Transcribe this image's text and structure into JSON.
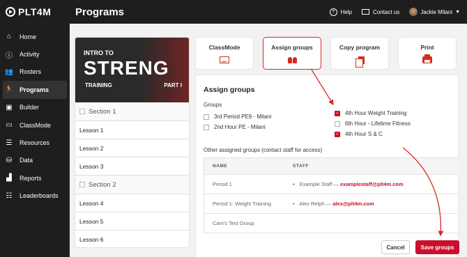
{
  "app": {
    "logo_text": "PLT4M",
    "page_title": "Programs"
  },
  "header": {
    "help_label": "Help",
    "contact_label": "Contact us",
    "user_name": "Jackie Milani"
  },
  "sidebar": {
    "items": [
      {
        "label": "Home",
        "icon": "home-icon",
        "active": false
      },
      {
        "label": "Activity",
        "icon": "activity-icon",
        "active": false
      },
      {
        "label": "Rosters",
        "icon": "people-icon",
        "active": false
      },
      {
        "label": "Programs",
        "icon": "runner-icon",
        "active": true
      },
      {
        "label": "Builder",
        "icon": "toolbox-icon",
        "active": false
      },
      {
        "label": "ClassMode",
        "icon": "classmode-icon",
        "active": false
      },
      {
        "label": "Resources",
        "icon": "resources-icon",
        "active": false
      },
      {
        "label": "Data",
        "icon": "database-icon",
        "active": false
      },
      {
        "label": "Reports",
        "icon": "chart-icon",
        "active": false
      },
      {
        "label": "Leaderboards",
        "icon": "list-icon",
        "active": false
      }
    ]
  },
  "program": {
    "hero": {
      "line1": "INTRO TO",
      "line2": "STRENG",
      "line3": "TRAINING",
      "line4": "PART I"
    },
    "sections": [
      {
        "title": "Section 1",
        "lessons": [
          "Lesson 1",
          "Lesson 2",
          "Lesson 3"
        ]
      },
      {
        "title": "Section 2",
        "lessons": [
          "Lesson 4",
          "Lesson 5",
          "Lesson 6"
        ]
      }
    ]
  },
  "actions": [
    {
      "label": "ClassMode",
      "icon": "classmode-icon"
    },
    {
      "label": "Assign groups",
      "icon": "groups-icon"
    },
    {
      "label": "Copy program",
      "icon": "copy-icon"
    },
    {
      "label": "Print",
      "icon": "printer-icon"
    }
  ],
  "assign": {
    "title": "Assign groups",
    "groups_label": "Groups",
    "groups_left": [
      {
        "label": "3rd Period PE9 - Milani",
        "checked": false
      },
      {
        "label": "2nd Hour PE - Milani",
        "checked": false
      }
    ],
    "groups_right": [
      {
        "label": "4th Hour Weight Training",
        "checked": true
      },
      {
        "label": "6th Hour - Lifetime Fitness",
        "checked": false
      },
      {
        "label": "4th Hour S & C",
        "checked": true
      }
    ],
    "other_label": "Other assigned groups (contact staff for access)",
    "table": {
      "headers": {
        "name": "NAME",
        "staff": "STAFF"
      },
      "rows": [
        {
          "name": "Period 1",
          "staff_name": "Example Staff —",
          "staff_email": "examplestaff@plt4m.com"
        },
        {
          "name": "Period 1: Weight Training",
          "staff_name": "Alex Relph —",
          "staff_email": "alex@plt4m.com"
        },
        {
          "name": "Cam's Test Group",
          "staff_name": "",
          "staff_email": ""
        }
      ]
    },
    "cancel_label": "Cancel",
    "save_label": "Save groups"
  },
  "colors": {
    "accent": "#c8102e",
    "sidebar_bg": "#1e1e1e"
  }
}
